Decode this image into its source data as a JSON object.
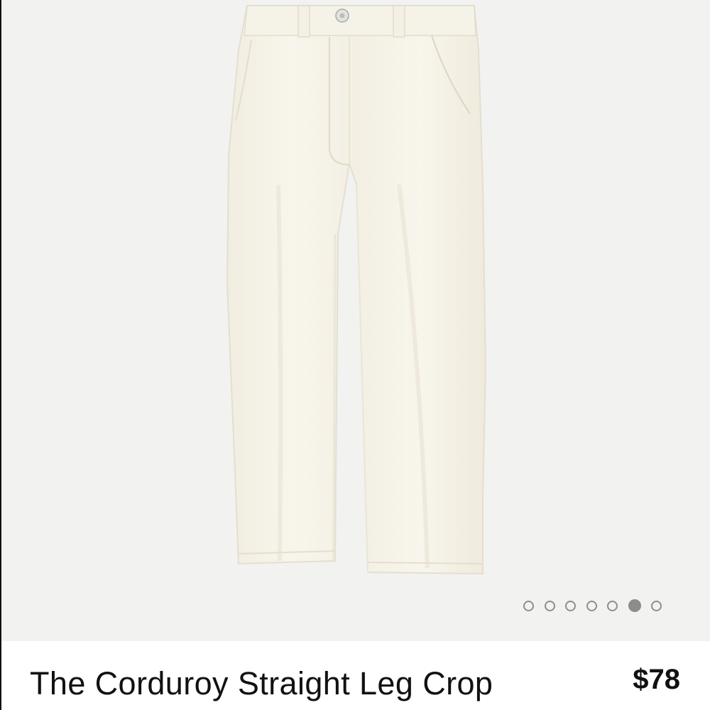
{
  "product": {
    "title": "The Corduroy Straight Leg Crop",
    "price": "$78",
    "image_subject": "cream-corduroy-straight-leg-pants"
  },
  "gallery": {
    "total_images": 7,
    "active_index": 6,
    "background_color": "#f2f2f1",
    "garment_color": "#f7f4ea"
  }
}
